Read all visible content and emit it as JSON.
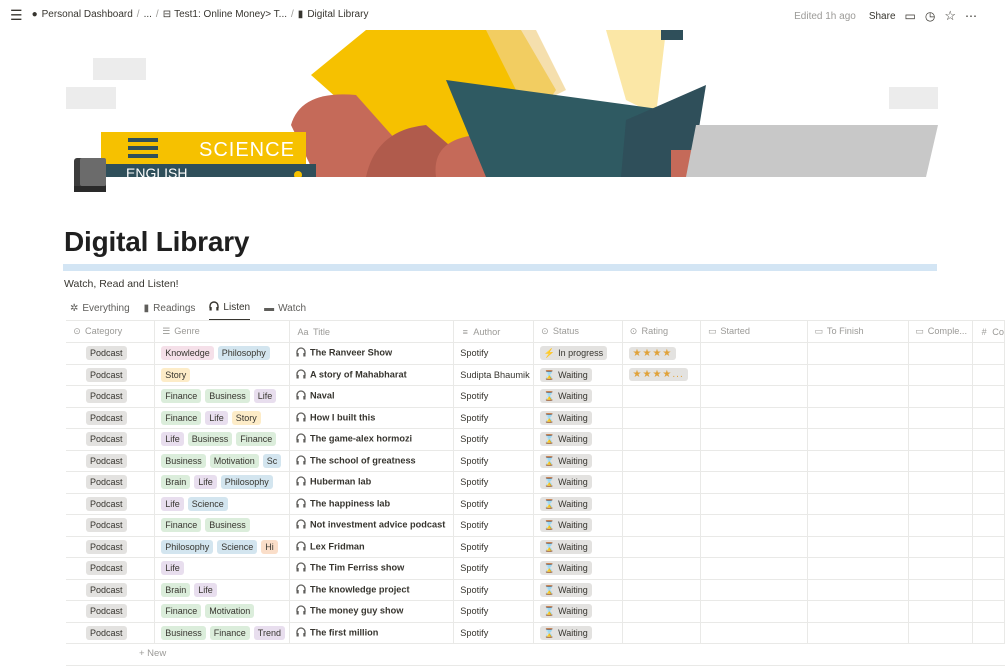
{
  "breadcrumb": {
    "items": [
      "Personal Dashboard",
      "...",
      "Test1: Online Money> T...",
      "Digital Library"
    ]
  },
  "topbar": {
    "edited": "Edited 1h ago",
    "share": "Share"
  },
  "cover": {
    "book_label": "SCIENCE",
    "book_label_2": "ENGLISH"
  },
  "page": {
    "title": "Digital Library",
    "description": "Watch, Read and Listen!"
  },
  "views": [
    "Everything",
    "Readings",
    "Listen",
    "Watch"
  ],
  "active_view": "Listen",
  "columns": [
    {
      "label": "Category",
      "icon": "select-icon"
    },
    {
      "label": "Genre",
      "icon": "list-icon"
    },
    {
      "label": "Title",
      "icon": "text-icon"
    },
    {
      "label": "Author",
      "icon": "lines-icon"
    },
    {
      "label": "Status",
      "icon": "select-icon"
    },
    {
      "label": "Rating",
      "icon": "select-icon"
    },
    {
      "label": "Started",
      "icon": "calendar-icon"
    },
    {
      "label": "To Finish",
      "icon": "calendar-icon"
    },
    {
      "label": "Comple...",
      "icon": "calendar-icon"
    },
    {
      "label": "Co",
      "icon": "hash-icon"
    }
  ],
  "column_icon_text": {
    "select": "⊙",
    "list": "☰",
    "text": "Aa",
    "lines": "≡",
    "calendar": "▭",
    "hash": "#"
  },
  "tag_colors": {
    "Knowledge": "#f5e0e9",
    "Philosophy": "#d3e5ef",
    "Story": "#fdecc8",
    "Finance": "#dbeddb",
    "Business": "#dbeddb",
    "Life": "#e8deee",
    "Motivation": "#dbeddb",
    "Brain": "#dbeddb",
    "Science": "#d3e5ef",
    "Hi": "#fadec9",
    "Trend": "#e8deee",
    "Sc": "#d3e5ef"
  },
  "rows": [
    {
      "category": "Podcast",
      "genre": [
        "Knowledge",
        "Philosophy"
      ],
      "title": "The Ranveer Show",
      "author": "Spotify",
      "status": "In progress",
      "status_icon": "⚡",
      "rating": "★★★★"
    },
    {
      "category": "Podcast",
      "genre": [
        "Story"
      ],
      "title": "A story of Mahabharat",
      "author": "Sudipta Bhaumik",
      "status": "Waiting",
      "status_icon": "⌛",
      "rating": "★★★★..."
    },
    {
      "category": "Podcast",
      "genre": [
        "Finance",
        "Business",
        "Life"
      ],
      "title": "Naval",
      "author": "Spotify",
      "status": "Waiting",
      "status_icon": "⌛",
      "rating": ""
    },
    {
      "category": "Podcast",
      "genre": [
        "Finance",
        "Life",
        "Story"
      ],
      "title": "How I built this",
      "author": "Spotify",
      "status": "Waiting",
      "status_icon": "⌛",
      "rating": ""
    },
    {
      "category": "Podcast",
      "genre": [
        "Life",
        "Business",
        "Finance"
      ],
      "title": "The game-alex hormozi",
      "author": "Spotify",
      "status": "Waiting",
      "status_icon": "⌛",
      "rating": ""
    },
    {
      "category": "Podcast",
      "genre": [
        "Business",
        "Motivation",
        "Sc"
      ],
      "title": "The school of greatness",
      "author": "Spotify",
      "status": "Waiting",
      "status_icon": "⌛",
      "rating": ""
    },
    {
      "category": "Podcast",
      "genre": [
        "Brain",
        "Life",
        "Philosophy"
      ],
      "title": "Huberman lab",
      "author": "Spotify",
      "status": "Waiting",
      "status_icon": "⌛",
      "rating": ""
    },
    {
      "category": "Podcast",
      "genre": [
        "Life",
        "Science"
      ],
      "title": "The happiness lab",
      "author": "Spotify",
      "status": "Waiting",
      "status_icon": "⌛",
      "rating": ""
    },
    {
      "category": "Podcast",
      "genre": [
        "Finance",
        "Business"
      ],
      "title": "Not investment advice podcast",
      "author": "Spotify",
      "status": "Waiting",
      "status_icon": "⌛",
      "rating": ""
    },
    {
      "category": "Podcast",
      "genre": [
        "Philosophy",
        "Science",
        "Hi"
      ],
      "title": "Lex Fridman",
      "author": "Spotify",
      "status": "Waiting",
      "status_icon": "⌛",
      "rating": ""
    },
    {
      "category": "Podcast",
      "genre": [
        "Life"
      ],
      "title": "The Tim Ferriss show",
      "author": "Spotify",
      "status": "Waiting",
      "status_icon": "⌛",
      "rating": ""
    },
    {
      "category": "Podcast",
      "genre": [
        "Brain",
        "Life"
      ],
      "title": "The knowledge project",
      "author": "Spotify",
      "status": "Waiting",
      "status_icon": "⌛",
      "rating": ""
    },
    {
      "category": "Podcast",
      "genre": [
        "Finance",
        "Motivation"
      ],
      "title": "The money guy show",
      "author": "Spotify",
      "status": "Waiting",
      "status_icon": "⌛",
      "rating": ""
    },
    {
      "category": "Podcast",
      "genre": [
        "Business",
        "Finance",
        "Trend"
      ],
      "title": "The first million",
      "author": "Spotify",
      "status": "Waiting",
      "status_icon": "⌛",
      "rating": ""
    }
  ],
  "new_row_label": "+ New"
}
